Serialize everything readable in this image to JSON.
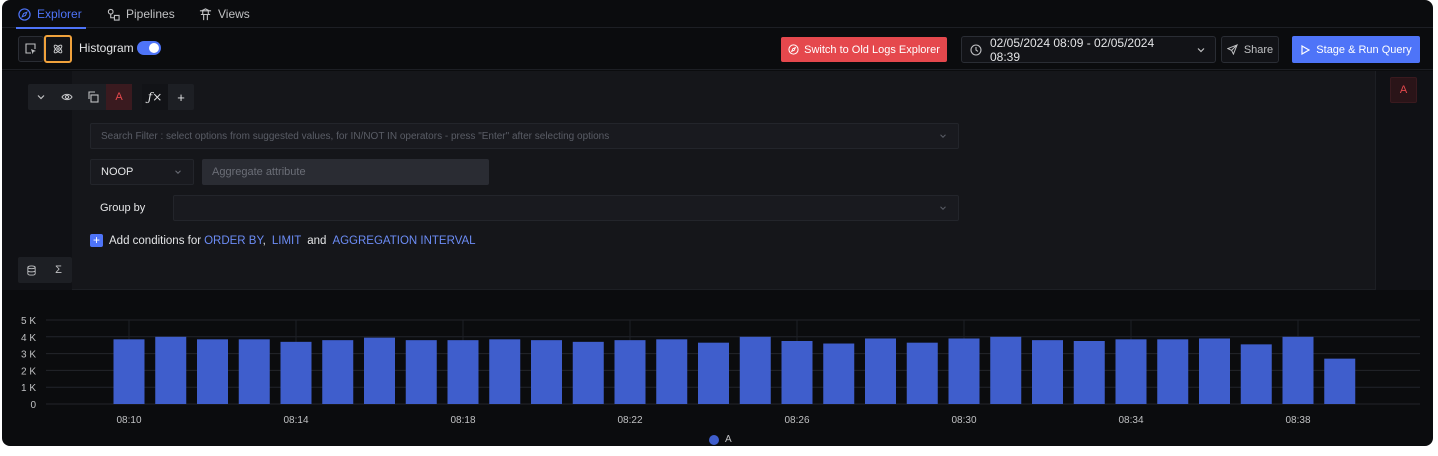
{
  "tabs": [
    {
      "label": "Explorer",
      "icon": "compass-icon",
      "active": true
    },
    {
      "label": "Pipelines",
      "icon": "pipelines-icon",
      "active": false
    },
    {
      "label": "Views",
      "icon": "views-icon",
      "active": false
    }
  ],
  "toolbar": {
    "histogram_label": "Histogram",
    "histogram_on": true,
    "switch_label": "Switch to Old Logs Explorer",
    "time_range": "02/05/2024 08:09 - 02/05/2024 08:39",
    "share_label": "Share",
    "run_label": "Stage & Run Query"
  },
  "query": {
    "letter": "A",
    "search_placeholder": "Search Filter : select options from suggested values, for IN/NOT IN operators - press \"Enter\" after selecting options",
    "aggregate_op": "NOOP",
    "aggregate_attr_placeholder": "Aggregate attribute",
    "group_by_label": "Group by",
    "add_conditions": {
      "prefix": "Add conditions for",
      "order_by": "ORDER BY",
      "comma": ",",
      "limit": "LIMIT",
      "and": "and",
      "interval": "AGGREGATION INTERVAL"
    },
    "sigma": "Σ",
    "plus": "+",
    "right_badge": "A"
  },
  "colors": {
    "accent": "#4e74f8",
    "danger": "#e5484d",
    "highlight_border": "#f0a23c",
    "bar": "#3f5ecc"
  },
  "chart_data": {
    "type": "bar",
    "values": [
      3850,
      4000,
      3850,
      3850,
      3700,
      3800,
      3950,
      3800,
      3800,
      3850,
      3800,
      3700,
      3800,
      3850,
      3650,
      4000,
      3750,
      3600,
      3900,
      3650,
      3900,
      4000,
      3800,
      3750,
      3850,
      3850,
      3900,
      3550,
      4000,
      2700
    ],
    "x_tick_labels": [
      "08:10",
      "08:14",
      "08:18",
      "08:22",
      "08:26",
      "08:30",
      "08:34",
      "08:38"
    ],
    "x_tick_bar_index": [
      0,
      4,
      8,
      12,
      16,
      20,
      24,
      28
    ],
    "y_ticks": [
      0,
      1000,
      2000,
      3000,
      4000,
      5000
    ],
    "y_tick_labels": [
      "0",
      "1 K",
      "2 K",
      "3 K",
      "4 K",
      "5 K"
    ],
    "ylim": [
      0,
      5000
    ],
    "legend": [
      {
        "name": "A",
        "color": "#3f5ecc"
      }
    ],
    "legend_position": "bottom-center",
    "grid": true
  }
}
